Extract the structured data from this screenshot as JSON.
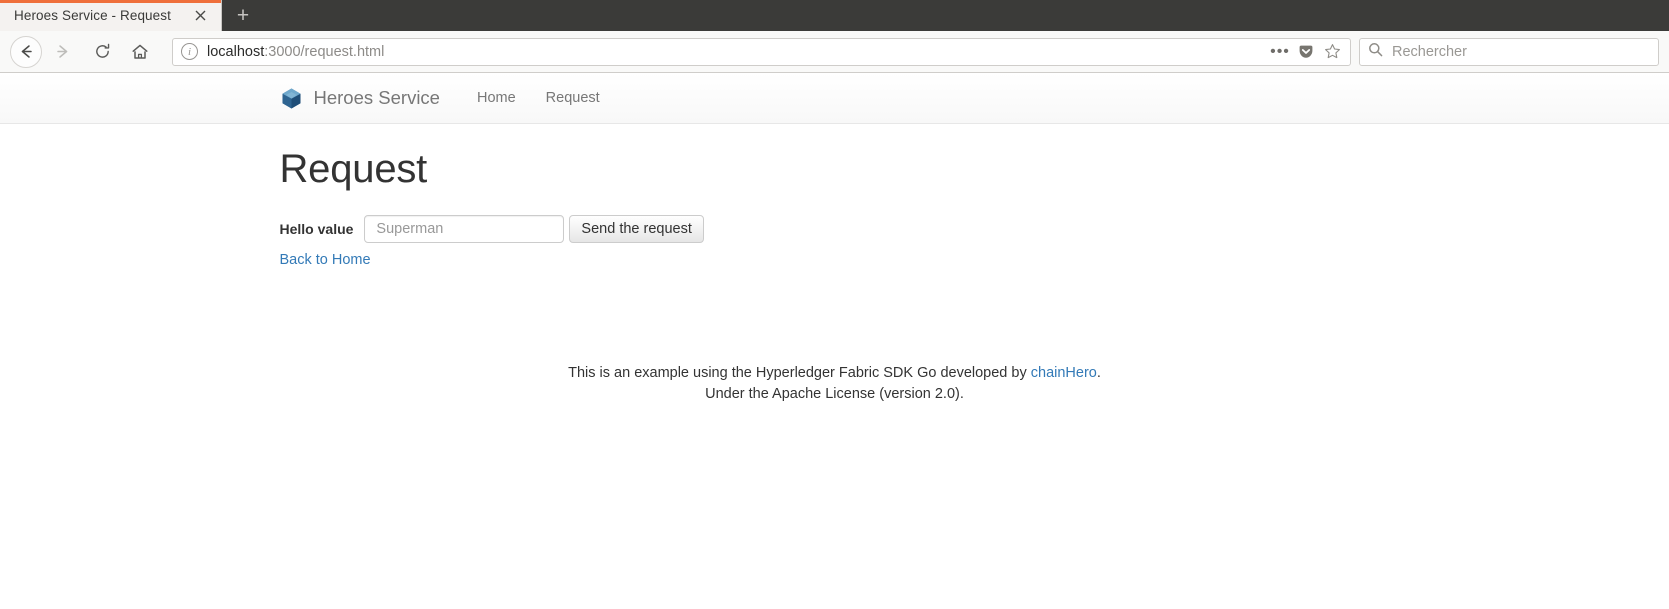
{
  "browser": {
    "tab": {
      "title": "Heroes Service - Request",
      "close_icon": "close-icon",
      "accent_color": "#ef6f3b"
    },
    "new_tab_label": "+",
    "toolbar": {
      "back_icon": "back-arrow-icon",
      "forward_icon": "forward-arrow-icon",
      "reload_icon": "reload-icon",
      "home_icon": "home-icon"
    },
    "url_bar": {
      "info_icon": "info-icon",
      "host": "localhost",
      "path": ":3000/request.html",
      "full_url": "localhost:3000/request.html",
      "page_actions_icon": "ellipsis-icon",
      "pocket_icon": "pocket-icon",
      "bookmark_icon": "star-icon"
    },
    "search_bar": {
      "search_icon": "search-icon",
      "placeholder": "Rechercher",
      "value": ""
    }
  },
  "site": {
    "nav": {
      "logo_icon": "hyperledger-cube-logo-icon",
      "brand": "Heroes Service",
      "links": [
        {
          "label": "Home"
        },
        {
          "label": "Request"
        }
      ]
    },
    "main": {
      "title": "Request",
      "form": {
        "label": "Hello value",
        "input_placeholder": "Superman",
        "input_value": "",
        "submit_label": "Send the request"
      },
      "back_link": "Back to Home"
    },
    "footer": {
      "line1_pre": "This is an example using the Hyperledger Fabric SDK Go developed by ",
      "line1_link": "chainHero",
      "line1_post": ".",
      "line2": "Under the Apache License (version 2.0)."
    }
  },
  "colors": {
    "brand_blue": "#2a6496",
    "link_blue": "#337ab7",
    "tab_accent": "#ef6f3b",
    "chrome_dark": "#3b3b39"
  }
}
